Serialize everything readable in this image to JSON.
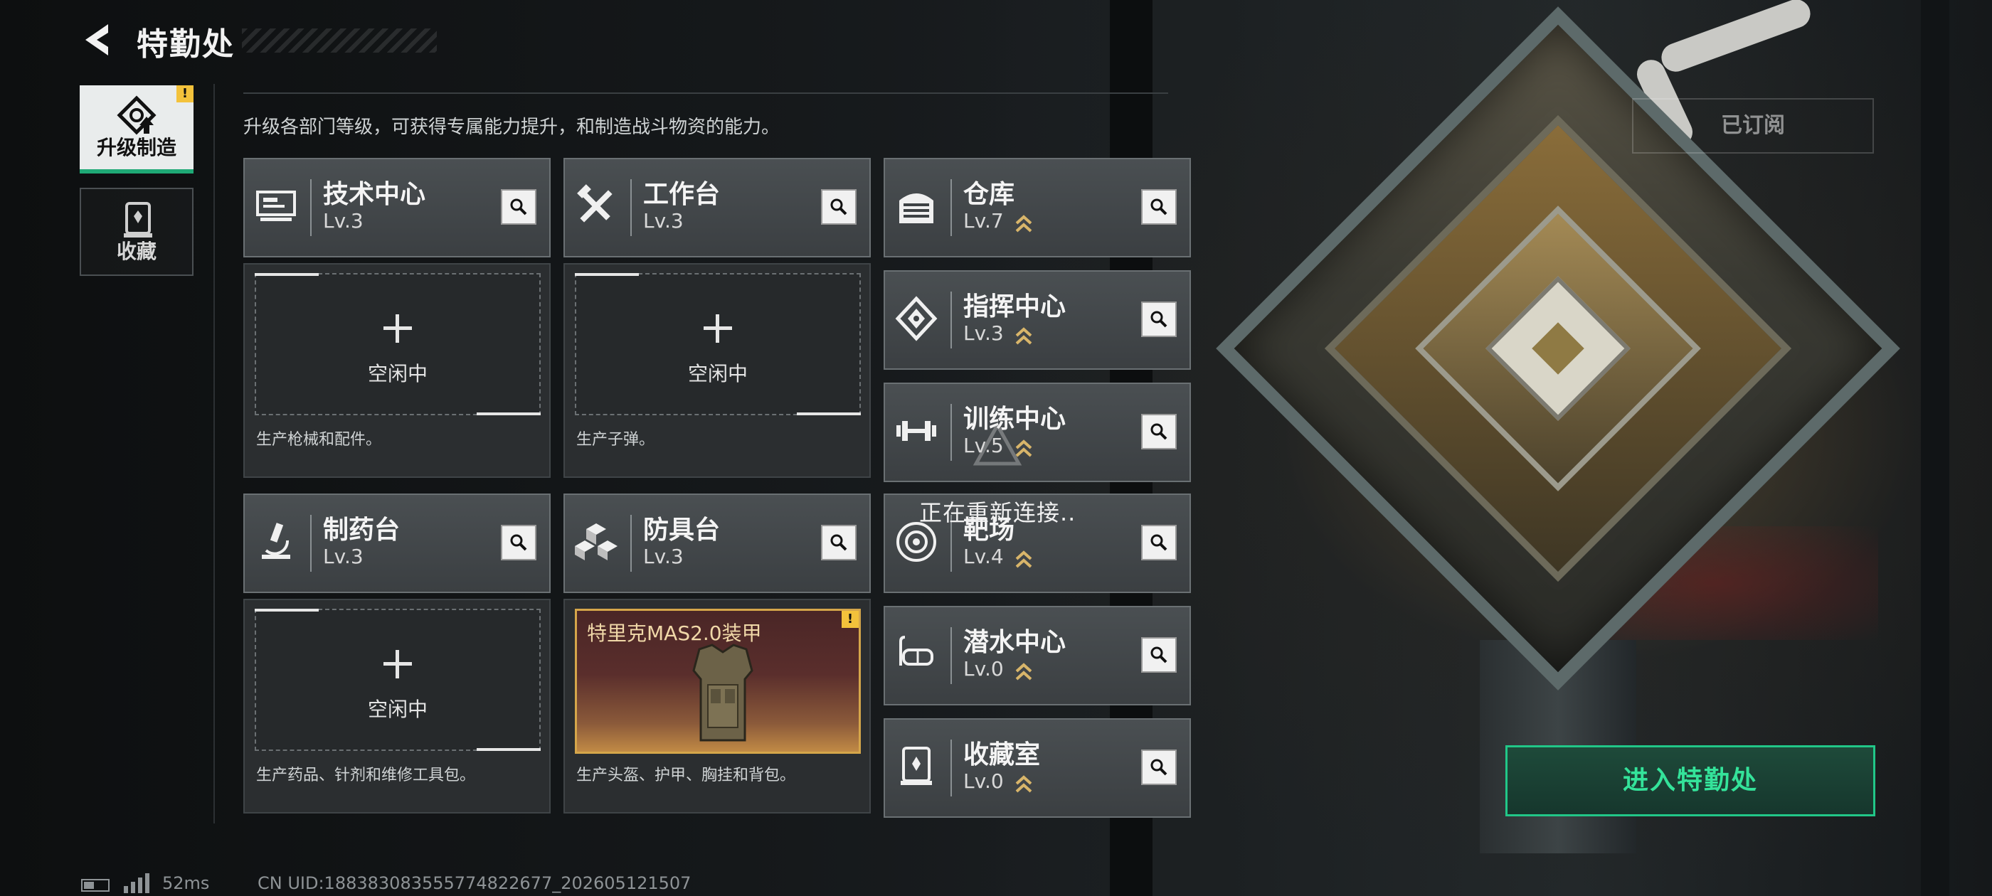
{
  "header": {
    "title": "特勤处"
  },
  "tabs": [
    {
      "label": "升级制造",
      "active": true,
      "alert": "!"
    },
    {
      "label": "收藏",
      "active": false
    }
  ],
  "description": "升级各部门等级，可获得专属能力提升，和制造战斗物资的能力。",
  "subscribe_label": "已订阅",
  "level_prefix": "Lv.",
  "production_cards": [
    {
      "name": "技术中心",
      "level": "Lv.3",
      "icon": "tech-center-icon",
      "slot_status": "空闲中",
      "produce": "生产枪械和配件。"
    },
    {
      "name": "工作台",
      "level": "Lv.3",
      "icon": "workbench-tools-icon",
      "slot_status": "空闲中",
      "produce": "生产子弹。"
    },
    {
      "name": "制药台",
      "level": "Lv.3",
      "icon": "microscope-icon",
      "slot_status": "空闲中",
      "produce": "生产药品、针剂和维修工具包。"
    },
    {
      "name": "防具台",
      "level": "Lv.3",
      "icon": "armor-blocks-icon",
      "slot_item": "特里克MAS2.0装甲",
      "slot_alert": "!",
      "produce": "生产头盔、护甲、胸挂和背包。"
    }
  ],
  "facility_cards": [
    {
      "name": "仓库",
      "level": "Lv.7",
      "icon": "warehouse-icon",
      "upgrade": true
    },
    {
      "name": "指挥中心",
      "level": "Lv.3",
      "icon": "command-center-icon",
      "upgrade": true
    },
    {
      "name": "训练中心",
      "level": "Lv.5",
      "icon": "dumbbell-icon",
      "upgrade": true
    },
    {
      "name": "靶场",
      "level": "Lv.4",
      "icon": "target-icon",
      "upgrade": true
    },
    {
      "name": "潜水中心",
      "level": "Lv.0",
      "icon": "diving-mask-icon",
      "upgrade": true
    },
    {
      "name": "收藏室",
      "level": "Lv.0",
      "icon": "collection-room-icon",
      "upgrade": true
    }
  ],
  "reconnect_text": "正在重新连接..",
  "enter_button": "进入特勤处",
  "status_bar": {
    "ping": "52ms",
    "uid": "CN UID:1883830835557748226​77_202605121507"
  },
  "colors": {
    "accent": "#21c788",
    "alert": "#f3c23b",
    "upgrade": "#d8b56a"
  }
}
